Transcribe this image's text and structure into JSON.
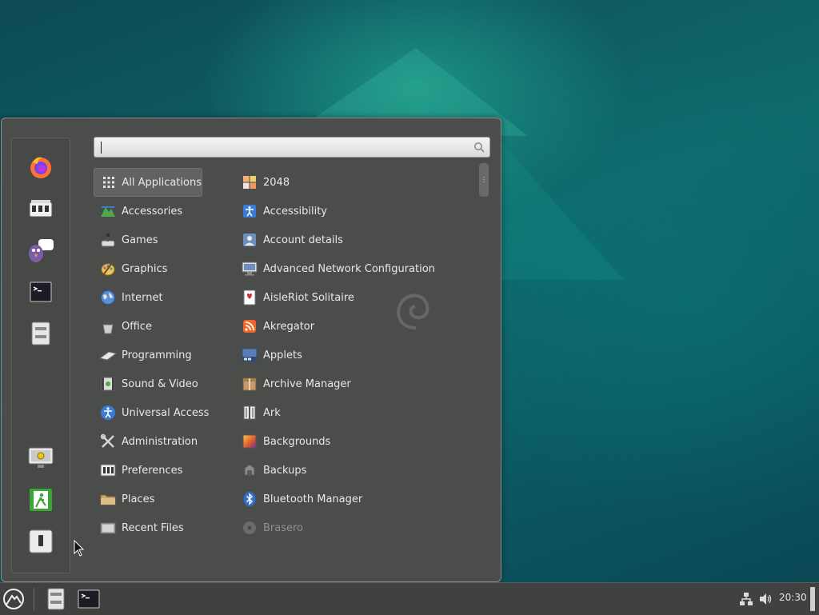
{
  "search": {
    "placeholder": "",
    "value": ""
  },
  "favorites": [
    {
      "name": "firefox-icon"
    },
    {
      "name": "software-manager-icon"
    },
    {
      "name": "pidgin-icon"
    },
    {
      "name": "terminal-icon"
    },
    {
      "name": "file-manager-icon"
    }
  ],
  "session": [
    {
      "name": "lock-screen-icon"
    },
    {
      "name": "logout-icon"
    },
    {
      "name": "shutdown-icon"
    }
  ],
  "categories": [
    {
      "label": "All Applications",
      "icon": "grid-icon",
      "selected": true
    },
    {
      "label": "Accessories",
      "icon": "accessories-icon"
    },
    {
      "label": "Games",
      "icon": "games-icon"
    },
    {
      "label": "Graphics",
      "icon": "graphics-icon"
    },
    {
      "label": "Internet",
      "icon": "internet-icon"
    },
    {
      "label": "Office",
      "icon": "office-icon"
    },
    {
      "label": "Programming",
      "icon": "programming-icon"
    },
    {
      "label": "Sound & Video",
      "icon": "sound-video-icon"
    },
    {
      "label": "Universal Access",
      "icon": "universal-access-icon"
    },
    {
      "label": "Administration",
      "icon": "administration-icon"
    },
    {
      "label": "Preferences",
      "icon": "preferences-icon"
    },
    {
      "label": "Places",
      "icon": "folder-icon"
    },
    {
      "label": "Recent Files",
      "icon": "recent-files-icon"
    }
  ],
  "apps": [
    {
      "label": "2048",
      "icon": "game-2048-icon"
    },
    {
      "label": "Accessibility",
      "icon": "accessibility-icon"
    },
    {
      "label": "Account details",
      "icon": "account-icon"
    },
    {
      "label": "Advanced Network Configuration",
      "icon": "network-config-icon"
    },
    {
      "label": "AisleRiot Solitaire",
      "icon": "cards-icon"
    },
    {
      "label": "Akregator",
      "icon": "rss-icon"
    },
    {
      "label": "Applets",
      "icon": "applets-icon"
    },
    {
      "label": "Archive Manager",
      "icon": "archive-icon"
    },
    {
      "label": "Ark",
      "icon": "ark-icon"
    },
    {
      "label": "Backgrounds",
      "icon": "backgrounds-icon"
    },
    {
      "label": "Backups",
      "icon": "backups-icon"
    },
    {
      "label": "Bluetooth Manager",
      "icon": "bluetooth-icon"
    },
    {
      "label": "Brasero",
      "icon": "disc-icon",
      "disabled": true
    }
  ],
  "panel": {
    "clock": "20:30"
  },
  "colors": {
    "menu_bg": "#4b4d4b",
    "panel_bg": "#404240",
    "selected_bg": "#616361",
    "desktop_teal": "#0f6a6c"
  }
}
